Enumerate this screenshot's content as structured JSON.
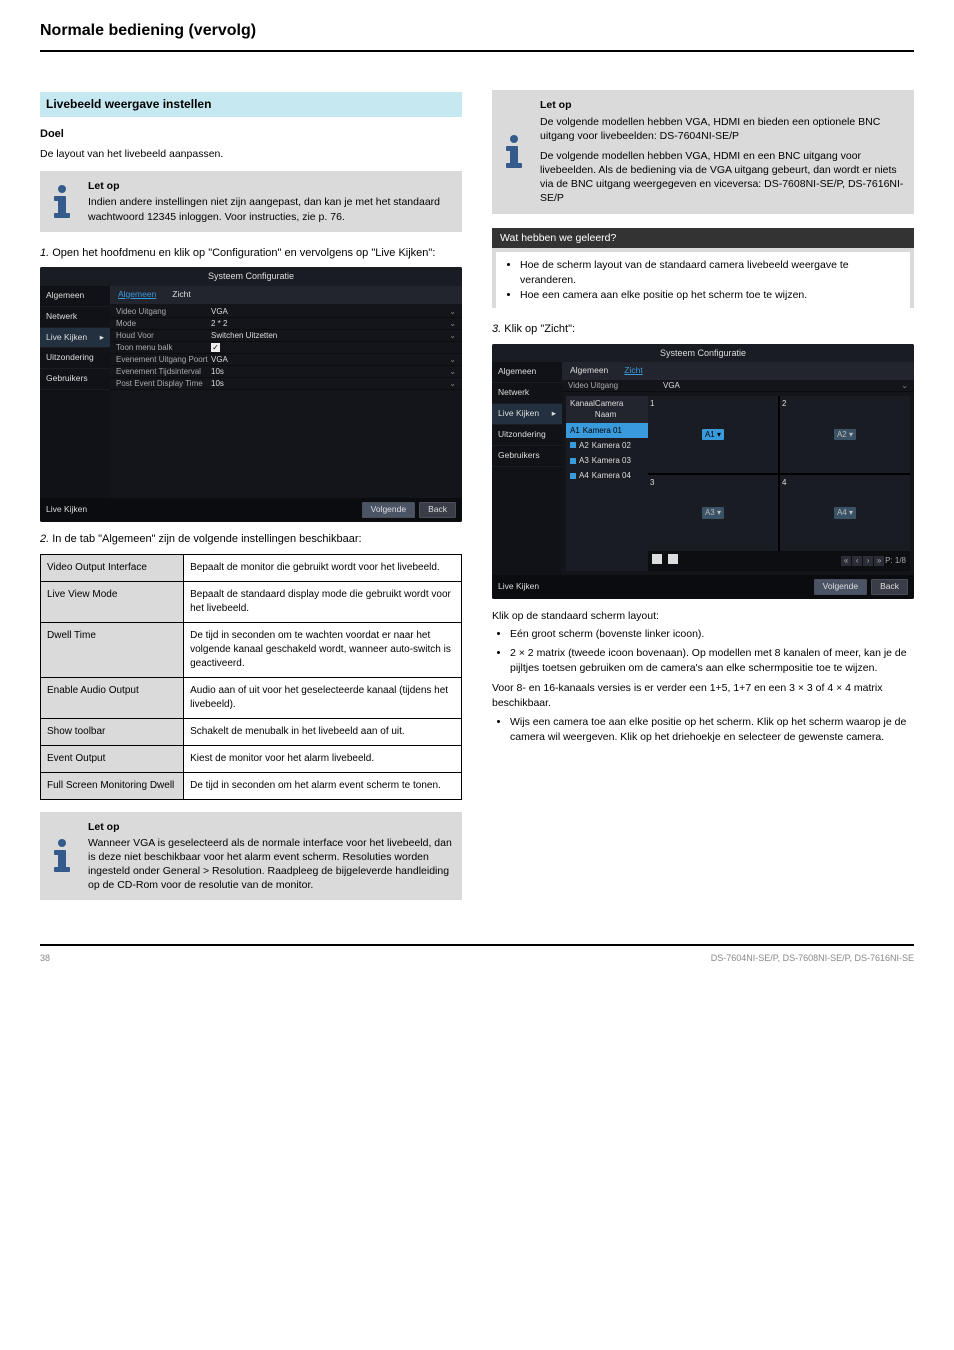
{
  "chapter_title": "Normale bediening (vervolg)",
  "left": {
    "section": "Livebeeld weergave instellen",
    "purpose_title": "Doel",
    "purpose_text": "De layout van het livebeeld aanpassen.",
    "info": {
      "label": "Let op",
      "text": "Indien andere instellingen niet zijn aangepast, dan kan je met het standaard wachtwoord 12345 inloggen. Voor instructies, zie p. 76."
    },
    "step1": {
      "num": "1.",
      "text": "Open het hoofdmenu en klik op \"Configuration\" en vervolgens op \"Live Kijken\":"
    },
    "sysconf": {
      "title": "Systeem Configuratie",
      "side": [
        "Algemeen",
        "Netwerk",
        "Live Kijken",
        "Uitzondering",
        "Gebruikers"
      ],
      "active_side": 2,
      "tabs": [
        "Algemeen",
        "Zicht"
      ],
      "active_tab": 0,
      "rows": [
        {
          "label": "Video Uitgang",
          "value": "VGA",
          "dd": true
        },
        {
          "label": "Mode",
          "value": "2 * 2",
          "dd": true
        },
        {
          "label": "Houd Voor",
          "value": "Switchen Uitzetten",
          "dd": true
        },
        {
          "label": "Toon menu balk",
          "value": "",
          "check": true
        },
        {
          "label": "Evenement Uitgang Poort",
          "value": "VGA",
          "dd": true
        },
        {
          "label": "Evenement Tijdsinterval",
          "value": "10s",
          "dd": true
        },
        {
          "label": "Post Event Display Time",
          "value": "10s",
          "dd": true
        }
      ],
      "footer_left": "Live Kijken",
      "btn_prev": "Volgende",
      "btn_back": "Back"
    },
    "step2": {
      "num": "2.",
      "text": "In de tab \"Algemeen\" zijn de volgende instellingen beschikbaar:"
    },
    "table": [
      {
        "key": "Video Output Interface",
        "val": "Bepaalt de monitor die gebruikt wordt voor het livebeeld."
      },
      {
        "key": "Live View Mode",
        "val": "Bepaalt de standaard display mode die gebruikt wordt voor het livebeeld."
      },
      {
        "key": "Dwell Time",
        "val": "De tijd in seconden om te wachten voordat er naar het volgende kanaal geschakeld wordt, wanneer auto-switch is geactiveerd."
      },
      {
        "key": "Enable Audio Output",
        "val": "Audio aan of uit voor het geselecteerde kanaal (tijdens het livebeeld)."
      },
      {
        "key": "Show toolbar",
        "val": "Schakelt de menubalk in het livebeeld aan of uit."
      },
      {
        "key": "Event Output",
        "val": "Kiest de monitor voor het alarm livebeeld."
      },
      {
        "key": "Full Screen Monitoring Dwell",
        "val": "De tijd in seconden om het alarm event scherm te tonen."
      }
    ],
    "info2": {
      "label": "Let op",
      "text": "Wanneer VGA is geselecteerd als de normale interface voor het livebeeld, dan is deze niet beschikbaar voor het alarm event scherm. Resoluties worden ingesteld onder General > Resolution. Raadpleeg de bijgeleverde handleiding op de CD-Rom voor de resolutie van de monitor."
    }
  },
  "right": {
    "info": {
      "label": "Let op",
      "lines": [
        "De volgende modellen hebben VGA, HDMI en bieden een optionele BNC uitgang voor livebeelden: DS-7604NI-SE/P",
        "De volgende modellen hebben VGA, HDMI en een BNC uitgang voor livebeelden. Als de bediening via de VGA uitgang gebeurt, dan wordt er niets via de BNC uitgang weergegeven en viceversa: DS-7608NI-SE/P, DS-7616NI-SE/P"
      ]
    },
    "learned": {
      "title": "Wat hebben we geleerd?",
      "items": [
        "Hoe de scherm layout van de standaard camera livebeeld weergave te veranderen.",
        "Hoe een camera aan elke positie op het scherm toe te wijzen."
      ]
    },
    "step3": {
      "num": "3.",
      "text": "Klik op \"Zicht\":"
    },
    "sysconf2": {
      "title": "Systeem Configuratie",
      "side": [
        "Algemeen",
        "Netwerk",
        "Live Kijken",
        "Uitzondering",
        "Gebruikers"
      ],
      "active_side": 2,
      "tabs": [
        "Algemeen",
        "Zicht"
      ],
      "active_tab": 1,
      "video_row": {
        "label": "Video Uitgang",
        "value": "VGA"
      },
      "cam_hdr_left": "Kanaal",
      "cam_hdr_right": "Camera Naam",
      "cams": [
        "Kamera 01",
        "Kamera 02",
        "Kamera 03",
        "Kamera 04"
      ],
      "cam_codes": [
        "A1",
        "A2",
        "A3",
        "A4"
      ],
      "tiles": [
        "A1",
        "A2",
        "A3",
        "A4"
      ],
      "pager": "P: 1/8",
      "footer_left": "Live Kijken",
      "btn_prev": "Volgende",
      "btn_back": "Back"
    },
    "step4_head": "Klik op de standaard scherm layout:",
    "bullets4": [
      "Eén groot scherm (bovenste linker icoon).",
      "2 × 2 matrix (tweede icoon bovenaan). Op modellen met 8 kanalen of meer, kan je de pijltjes toetsen gebruiken om de camera's aan elke schermpositie toe te wijzen."
    ],
    "para4": "Voor 8- en 16-kanaals versies is er verder een 1+5, 1+7 en een 3 × 3 of 4 × 4 matrix beschikbaar.",
    "bullets5": [
      "Wijs een camera toe aan elke positie op het scherm. Klik op het scherm waarop je de camera wil weergeven. Klik op het driehoekje en selecteer de gewenste camera."
    ]
  },
  "footer_left": "38",
  "footer_right": "DS-7604NI-SE/P, DS-7608NI-SE/P, DS-7616NI-SE"
}
